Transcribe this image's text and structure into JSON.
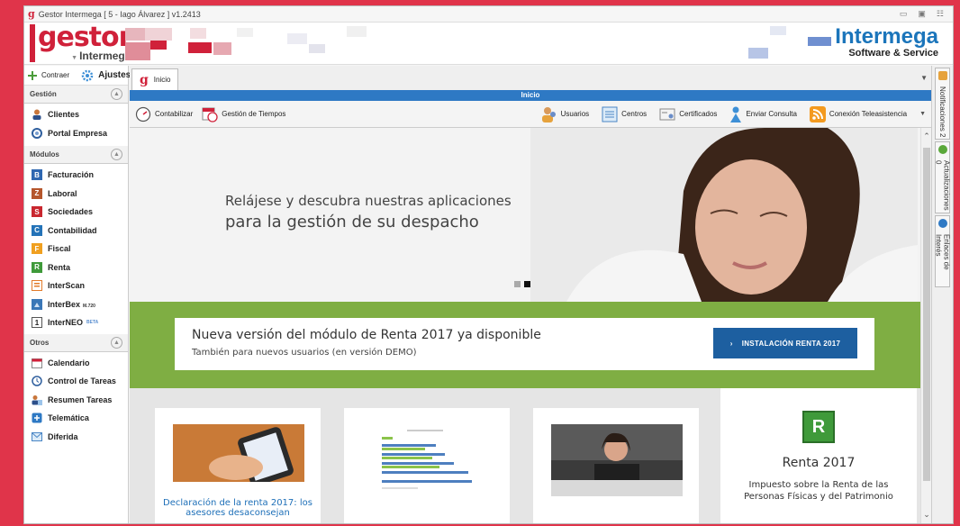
{
  "window": {
    "title": "Gestor Intermega [ 5 - Iago Álvarez ]  v1.2413",
    "controls": [
      "▭",
      "▣",
      "☷"
    ]
  },
  "banner": {
    "gestor_big": "gestor",
    "gestor_small": "Intermega",
    "intermega_big": "Intermega",
    "intermega_small": "Software & Service"
  },
  "sidebar": {
    "contraer": "Contraer",
    "ajustes": "Ajustes",
    "sections": {
      "gestion": "Gestión",
      "modulos": "Módulos",
      "otros": "Otros"
    },
    "gestion_items": [
      {
        "label": "Clientes",
        "icon": "person-icon"
      },
      {
        "label": "Portal Empresa",
        "icon": "portal-icon"
      }
    ],
    "modulos_items": [
      {
        "label": "Facturación",
        "letter": "B",
        "color": "#2e67b1"
      },
      {
        "label": "Laboral",
        "letter": "Z",
        "color": "#b5562c"
      },
      {
        "label": "Sociedades",
        "letter": "S",
        "color": "#c9272f"
      },
      {
        "label": "Contabilidad",
        "letter": "C",
        "color": "#2473b8"
      },
      {
        "label": "Fiscal",
        "letter": "F",
        "color": "#f0a020"
      },
      {
        "label": "Renta",
        "letter": "R",
        "color": "#3f9a3a"
      },
      {
        "label": "InterScan",
        "letter": "",
        "color": "#e27b2b"
      },
      {
        "label": "InterBex",
        "suffix": "M.720",
        "letter": "",
        "color": "#3a77b7"
      },
      {
        "label": "InterNEO",
        "suffix": "BETA",
        "letter": "1",
        "color": "#e8a23a"
      }
    ],
    "otros_items": [
      {
        "label": "Calendario"
      },
      {
        "label": "Control de Tareas"
      },
      {
        "label": "Resumen Tareas"
      },
      {
        "label": "Telemática"
      },
      {
        "label": "Diferida"
      }
    ]
  },
  "tabs": [
    {
      "label": "Inicio"
    }
  ],
  "bluebar": "Inicio",
  "toolbar": {
    "left": [
      {
        "label": "Contabilizar"
      },
      {
        "label": "Gestión de Tiempos"
      }
    ],
    "right": [
      {
        "label": "Usuarios"
      },
      {
        "label": "Centros"
      },
      {
        "label": "Certificados"
      },
      {
        "label": "Enviar Consulta"
      },
      {
        "label": "Conexión Teleasistencia"
      }
    ]
  },
  "hero": {
    "line1": "Relájese y descubra nuestras aplicaciones",
    "line2": "para la gestión de su despacho"
  },
  "promo": {
    "title": "Nueva versión del módulo de Renta 2017 ya disponible",
    "subtitle": "También para nuevos usuarios (en versión DEMO)",
    "button": "INSTALACIÓN RENTA 2017"
  },
  "cards": [
    {
      "link": "Declaración de la renta 2017: los asesores desaconsejan"
    },
    {
      "link": ""
    },
    {
      "link": ""
    }
  ],
  "renta_card": {
    "letter": "R",
    "title": "Renta 2017",
    "desc": "Impuesto sobre la Renta de las Personas Físicas y del Patrimonio"
  },
  "rail": [
    {
      "label": "Notificaciones 2"
    },
    {
      "label": "Actualizaciones 0"
    },
    {
      "label": "Enlaces de Interés"
    }
  ],
  "colors": {
    "brand_red": "#d0213a",
    "brand_blue": "#1b75bb",
    "green": "#7fae43",
    "accent_blue": "#2e79c4"
  }
}
